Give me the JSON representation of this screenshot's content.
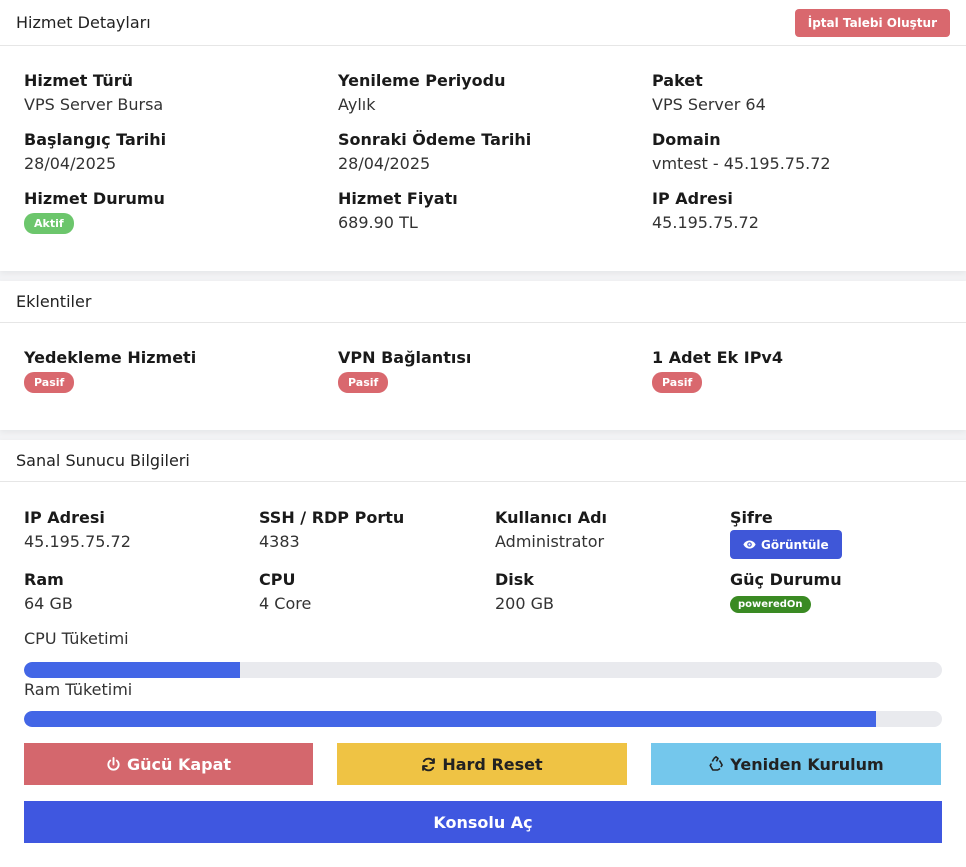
{
  "service_details": {
    "title": "Hizmet Detayları",
    "cancel_button": "İptal Talebi Oluştur",
    "fields": [
      {
        "label": "Hizmet Türü",
        "value": "VPS Server Bursa"
      },
      {
        "label": "Yenileme Periyodu",
        "value": "Aylık"
      },
      {
        "label": "Paket",
        "value": "VPS Server 64"
      },
      {
        "label": "Başlangıç Tarihi",
        "value": "28/04/2025"
      },
      {
        "label": "Sonraki Ödeme Tarihi",
        "value": "28/04/2025"
      },
      {
        "label": "Domain",
        "value": "vmtest - 45.195.75.72"
      },
      {
        "label": "Hizmet Durumu",
        "value": "Aktif"
      },
      {
        "label": "Hizmet Fiyatı",
        "value": "689.90 TL"
      },
      {
        "label": "IP Adresi",
        "value": "45.195.75.72"
      }
    ]
  },
  "addons": {
    "title": "Eklentiler",
    "items": [
      {
        "label": "Yedekleme Hizmeti",
        "status": "Pasif"
      },
      {
        "label": "VPN Bağlantısı",
        "status": "Pasif"
      },
      {
        "label": "1 Adet Ek IPv4",
        "status": "Pasif"
      }
    ]
  },
  "vps_info": {
    "title": "Sanal Sunucu Bilgileri",
    "fields": [
      {
        "label": "IP Adresi",
        "value": "45.195.75.72"
      },
      {
        "label": "SSH / RDP Portu",
        "value": "4383"
      },
      {
        "label": "Kullanıcı Adı",
        "value": "Administrator"
      },
      {
        "label": "Şifre",
        "value": "Görüntüle"
      },
      {
        "label": "Ram",
        "value": "64 GB"
      },
      {
        "label": "CPU",
        "value": "4 Core"
      },
      {
        "label": "Disk",
        "value": "200 GB"
      },
      {
        "label": "Güç Durumu",
        "value": "poweredOn"
      }
    ],
    "cpu_usage_label": "CPU Tüketimi",
    "cpu_usage_percent": 23.5,
    "ram_usage_label": "Ram Tüketimi",
    "ram_usage_percent": 92.8,
    "buttons": {
      "power_off": "Gücü Kapat",
      "hard_reset": "Hard Reset",
      "reinstall": "Yeniden Kurulum",
      "console": "Konsolu Aç"
    }
  },
  "colors": {
    "danger": "#d4676d",
    "warning": "#efc344",
    "info": "#74c7ec",
    "primary": "#3f57e0",
    "success": "#6cc66c",
    "powered_on": "#3a8a23",
    "progress": "#4366e6"
  },
  "icons": {
    "power_off": "power-icon",
    "hard_reset": "refresh-icon",
    "reinstall": "recycle-icon",
    "view_password": "eye-icon"
  }
}
